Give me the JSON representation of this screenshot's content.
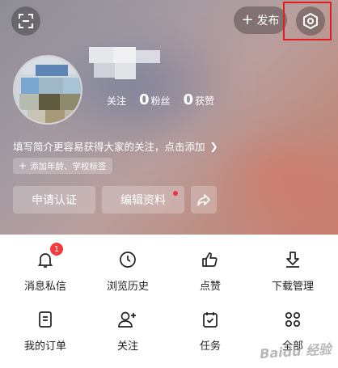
{
  "header": {
    "publish_label": "发布"
  },
  "profile": {
    "stats": [
      {
        "value": "",
        "label": "关注"
      },
      {
        "value": "0",
        "label": "粉丝"
      },
      {
        "value": "0",
        "label": "获赞"
      }
    ],
    "bio_prompt": "填写简介更容易获得大家的关注，点击添加",
    "tag_prompt": "添加年龄、学校标签",
    "certify_label": "申请认证",
    "edit_label": "编辑资料"
  },
  "menu": {
    "items": [
      {
        "label": "消息私信",
        "icon": "bell-icon",
        "badge": "1"
      },
      {
        "label": "浏览历史",
        "icon": "clock-icon"
      },
      {
        "label": "点赞",
        "icon": "thumbs-up-icon"
      },
      {
        "label": "下载管理",
        "icon": "download-icon"
      },
      {
        "label": "我的订单",
        "icon": "order-list-icon"
      },
      {
        "label": "关注",
        "icon": "follow-user-icon"
      },
      {
        "label": "任务",
        "icon": "calendar-check-icon"
      },
      {
        "label": "全部",
        "icon": "grid-circles-icon"
      }
    ]
  },
  "colors": {
    "badge": "#f23b3b",
    "highlight_box": "#e01e1e"
  }
}
